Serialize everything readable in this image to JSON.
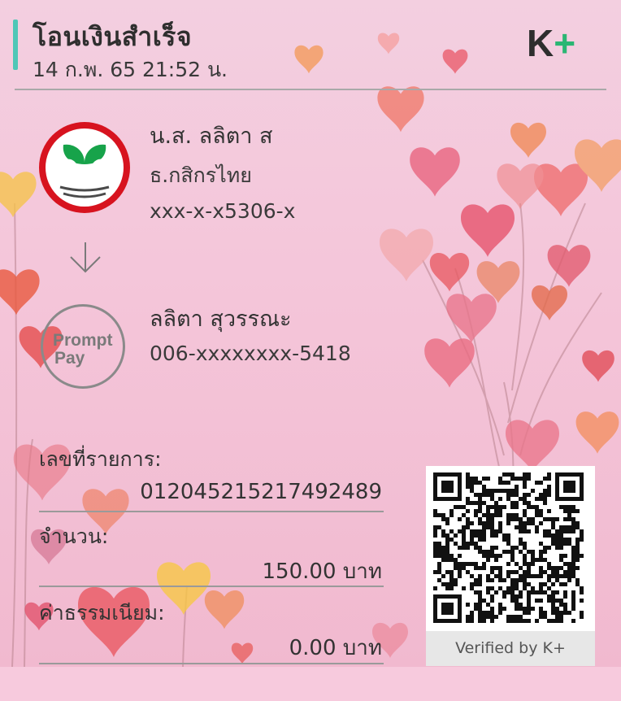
{
  "header": {
    "title": "โอนเงินสำเร็จ",
    "datetime": "14 ก.พ. 65  21:52 น.",
    "logo_k": "K",
    "logo_plus": "+"
  },
  "sender": {
    "name": "น.ส. ลลิตา ส",
    "bank": "ธ.กสิกรไทย",
    "account": "xxx-x-x5306-x"
  },
  "recipient": {
    "logo_line1": "Prompt",
    "logo_line2": "Pay",
    "name": "ลลิตา สุวรรณะ",
    "account": "006-xxxxxxxx-5418"
  },
  "transaction": {
    "ref_label": "เลขที่รายการ:",
    "ref_value": "012045215217492489",
    "amount_label": "จำนวน:",
    "amount_value": "150.00 บาท",
    "fee_label": "ค่าธรรมเนียม:",
    "fee_value": "0.00 บาท"
  },
  "qr": {
    "caption": "Verified by K+"
  },
  "colors": {
    "accent": "#4ec7b7",
    "brand_green": "#2bb673",
    "bank_red": "#d7131f",
    "kbank_green": "#17a34a"
  }
}
